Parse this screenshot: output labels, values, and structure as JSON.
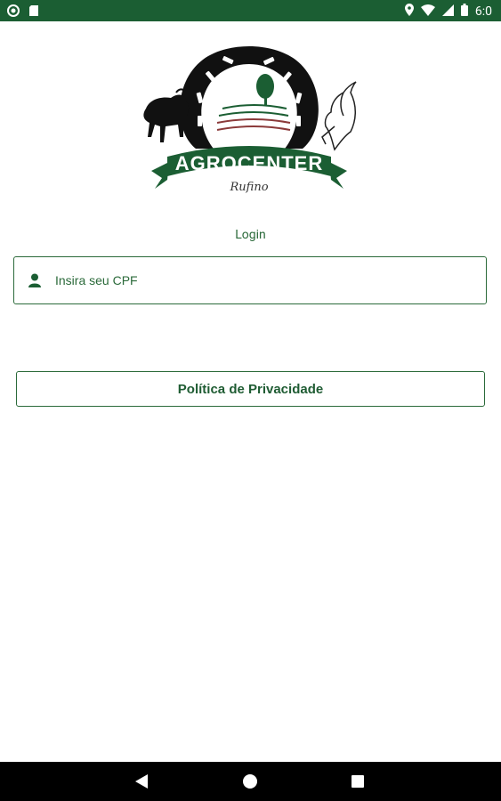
{
  "status_bar": {
    "time": "6:0",
    "icons": [
      "circle-icon",
      "sd-card-icon",
      "location-icon",
      "wifi-icon",
      "signal-icon",
      "battery-icon"
    ]
  },
  "logo": {
    "brand": "AGROCENTER",
    "signature": "Rufino"
  },
  "login": {
    "title": "Login",
    "cpf_placeholder": "Insira seu CPF",
    "cpf_value": ""
  },
  "privacy_button": {
    "label": "Política de Privacidade"
  },
  "colors": {
    "primary": "#1b5e33",
    "text": "#2b6a3a"
  },
  "nav": {
    "icons": [
      "back-icon",
      "home-icon",
      "recents-icon"
    ]
  }
}
